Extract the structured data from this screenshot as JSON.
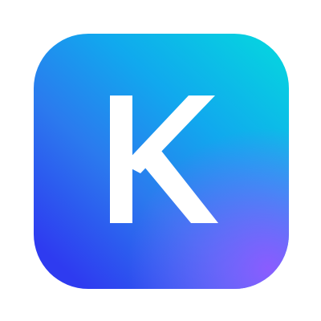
{
  "app_icon": {
    "letter": "K",
    "letter_color": "#ffffff",
    "gradient": {
      "top_right": "#06d3e0",
      "upper_left": "#11a8ee",
      "middle": "#2b7aee",
      "bottom_left": "#2e3bf0",
      "bottom_right": "#8a5cff"
    }
  }
}
